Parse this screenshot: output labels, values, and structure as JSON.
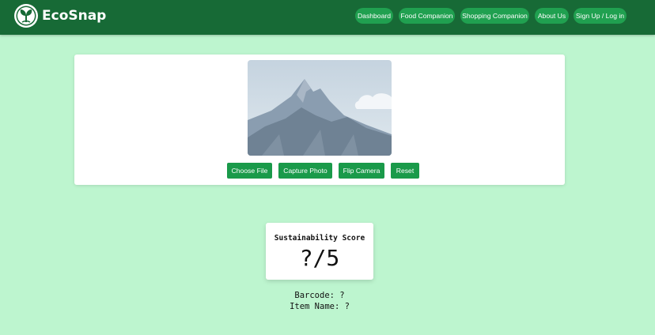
{
  "brand": {
    "name": "EcoSnap",
    "logo": "leaf-sprout-icon"
  },
  "nav": {
    "items": [
      {
        "label": "Dashboard"
      },
      {
        "label": "Food Companion"
      },
      {
        "label": "Shopping Companion"
      },
      {
        "label": "About Us"
      },
      {
        "label": "Sign Up / Log in"
      }
    ]
  },
  "camera": {
    "preview": "mountain-placeholder-image",
    "buttons": {
      "choose": "Choose File",
      "capture": "Capture Photo",
      "flip": "Flip Camera",
      "reset": "Reset"
    }
  },
  "score": {
    "title": "Sustainability Score",
    "value": "?/5"
  },
  "details": {
    "barcode": "Barcode: ?",
    "item_name": "Item Name: ?"
  },
  "colors": {
    "page_bg": "#bdf5cf",
    "navbar": "#176a36",
    "nav_pill": "#20a050",
    "button": "#1a9a4a",
    "card": "#ffffff"
  }
}
